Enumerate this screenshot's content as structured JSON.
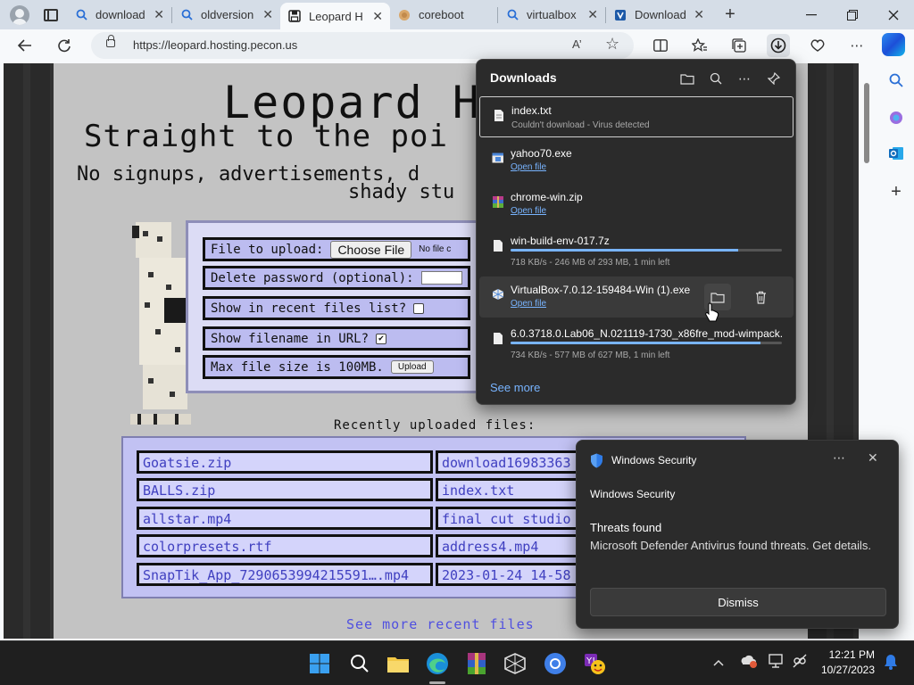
{
  "browser": {
    "tabs": [
      {
        "label": "download",
        "icon": "search-icon",
        "active": false
      },
      {
        "label": "oldversion",
        "icon": "search-icon",
        "active": false
      },
      {
        "label": "Leopard H",
        "icon": "floppy-disk-icon",
        "active": true
      },
      {
        "label": "coreboot",
        "icon": "globe-icon",
        "active": false
      },
      {
        "label": "virtualbox",
        "icon": "search-icon",
        "active": false
      },
      {
        "label": "Download",
        "icon": "virtualbox-icon",
        "active": false
      }
    ],
    "url": "https://leopard.hosting.pecon.us",
    "read_aloud_label": "A’"
  },
  "site": {
    "title": "Leopard H",
    "subtitle": "Straight to the poi",
    "desc_line1": "No signups, advertisements, d",
    "desc_line2": "shady stu",
    "form": {
      "file_label": "File to upload:",
      "choose_button": "Choose File",
      "no_file": "No file c",
      "delete_password_label": "Delete password (optional):",
      "show_recent_label": "Show in recent files list?",
      "show_recent_checked": false,
      "show_filename_label": "Show filename in URL?",
      "show_filename_checked": true,
      "max_size_label": "Max file size is 100MB.",
      "upload_button": "Upload"
    },
    "recent_title": "Recently uploaded files:",
    "recent_files_left": [
      "Goatsie.zip",
      "BALLS.zip",
      "allstar.mp4",
      "colorpresets.rtf",
      "SnapTik_App_7290653994215591….mp4"
    ],
    "recent_files_right": [
      "download16983363",
      "index.txt",
      "final cut studio",
      "address4.mp4",
      "2023-01-24 14-58"
    ],
    "see_more": "See more recent files"
  },
  "downloads": {
    "title": "Downloads",
    "items": [
      {
        "name": "index.txt",
        "status": "Couldn't download - Virus detected",
        "type": "text",
        "selected": true
      },
      {
        "name": "yahoo70.exe",
        "link": "Open file",
        "type": "exe"
      },
      {
        "name": "chrome-win.zip",
        "link": "Open file",
        "type": "zip"
      },
      {
        "name": "win-build-env-017.7z",
        "status": "718 KB/s - 246 MB of 293 MB, 1 min left",
        "progress": 0.84,
        "type": "file"
      },
      {
        "name": "VirtualBox-7.0.12-159484-Win (1).exe",
        "link": "Open file",
        "type": "virtualbox",
        "hovered": true
      },
      {
        "name": "6.0.3718.0.Lab06_N.021119-1730_x86fre_mod-wimpack...",
        "status": "734 KB/s - 577 MB of 627 MB, 1 min left",
        "progress": 0.92,
        "type": "file"
      }
    ],
    "see_more": "See more"
  },
  "toast": {
    "app_name": "Windows Security",
    "subtitle": "Windows Security",
    "heading": "Threats found",
    "body": "Microsoft Defender Antivirus found threats. Get details.",
    "dismiss": "Dismiss"
  },
  "taskbar": {
    "time": "12:21 PM",
    "date": "10/27/2023"
  },
  "colors": {
    "accent_blue": "#78b4ff",
    "link_purple": "#5050e0",
    "form_bg": "#dcdcf5"
  }
}
